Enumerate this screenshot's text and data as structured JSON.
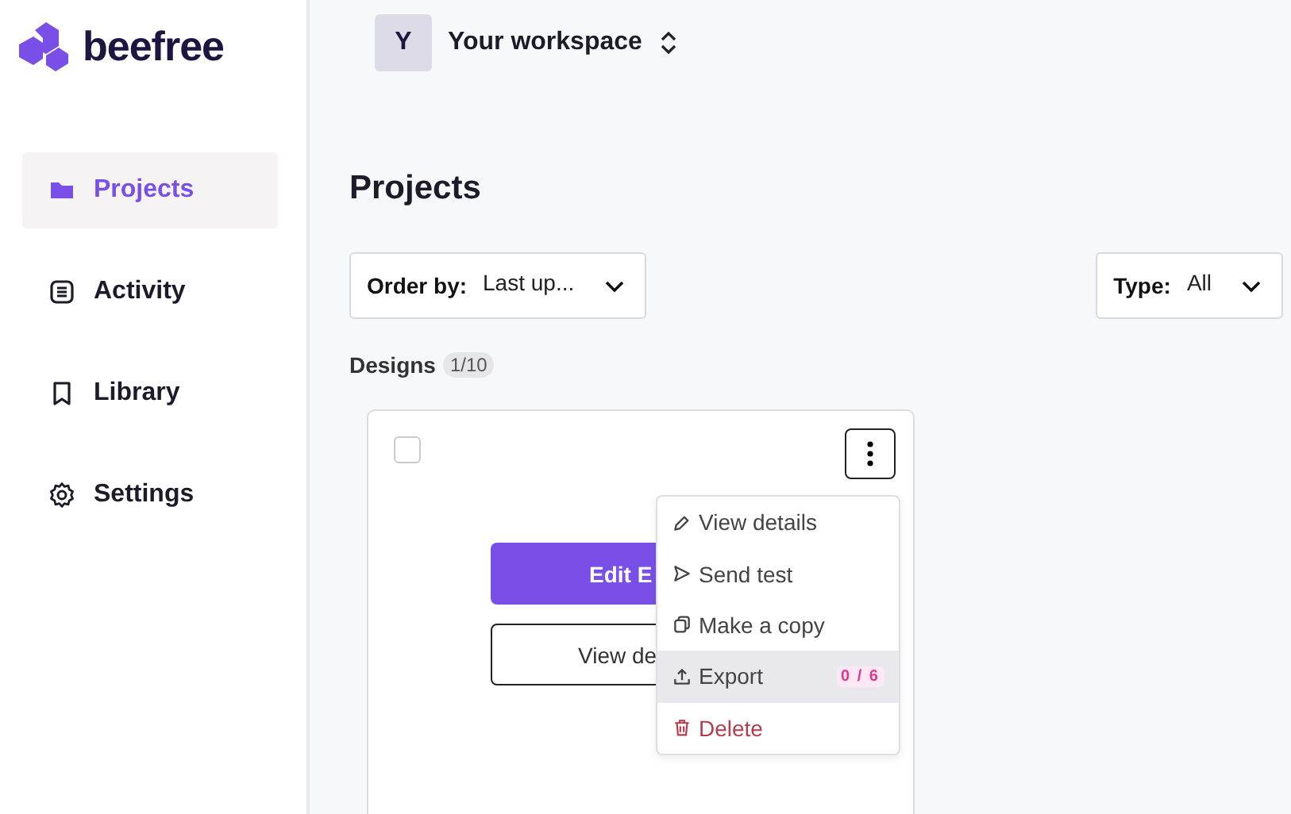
{
  "logo": {
    "text": "beefree"
  },
  "sidebar": {
    "items": [
      {
        "label": "Projects",
        "selected": true
      },
      {
        "label": "Activity",
        "selected": false
      },
      {
        "label": "Library",
        "selected": false
      },
      {
        "label": "Settings",
        "selected": false
      }
    ]
  },
  "workspace": {
    "avatar": "Y",
    "name": "Your workspace"
  },
  "heading": "Projects",
  "filters": [
    {
      "label": "Order by:",
      "value": "Last up..."
    },
    {
      "label": "Type:",
      "value": "All"
    }
  ],
  "designs": {
    "label": "Designs",
    "count": "1/10"
  },
  "card": {
    "checked": false,
    "primary_button": "Edit E",
    "secondary_button": "View de"
  },
  "menu": {
    "items": [
      {
        "label": "View details",
        "kind": "normal",
        "selected": false
      },
      {
        "label": "Send test",
        "kind": "normal",
        "selected": false
      },
      {
        "label": "Make a copy",
        "kind": "normal",
        "selected": false
      },
      {
        "label": "Export",
        "kind": "normal",
        "selected": true,
        "badge": "0 / 6"
      },
      {
        "label": "Delete",
        "kind": "danger",
        "selected": false
      }
    ]
  }
}
